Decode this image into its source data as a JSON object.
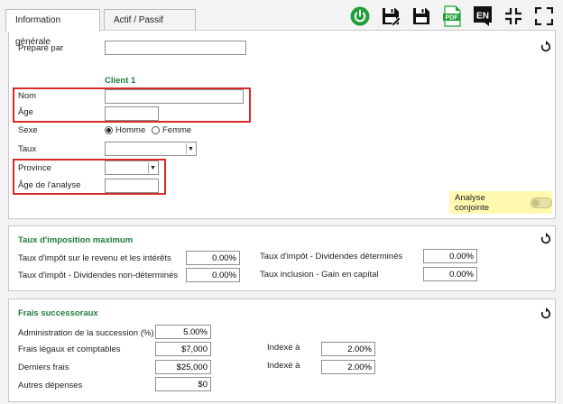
{
  "tabs": [
    {
      "label": "Information générale",
      "active": true
    },
    {
      "label": "Actif / Passif",
      "active": false
    }
  ],
  "toolbar": {
    "icons": [
      "power-icon",
      "save-edit-icon",
      "save-icon",
      "pdf-icon",
      "language-icon",
      "collapse-icon",
      "expand-icon"
    ],
    "pdf_label": "PDF",
    "language_label": "EN",
    "power_color": "#1f9e3a"
  },
  "general": {
    "prepared_by_label": "Préparé par",
    "prepared_by_value": "",
    "client_heading": "Client 1",
    "name_label": "Nom",
    "name_value": "",
    "age_label": "Âge",
    "age_value": "",
    "sex_label": "Sexe",
    "sex_options": [
      "Homme",
      "Femme"
    ],
    "sex_selected": "Homme",
    "rate_label": "Taux",
    "rate_value": "",
    "province_label": "Province",
    "province_value": "",
    "analysis_age_label": "Âge de l'analyse",
    "analysis_age_value": "",
    "joint_label": "Analyse conjointe",
    "joint_on": false
  },
  "tax": {
    "title": "Taux d'imposition maximum",
    "income_label": "Taux d'impôt sur le revenu et les intérêts",
    "income_value": "0.00%",
    "nondet_label": "Taux d'impôt - Dividendes non-déterminés",
    "nondet_value": "0.00%",
    "det_label": "Taux d'impôt - Dividendes déterminés",
    "det_value": "0.00%",
    "capgain_label": "Taux inclusion - Gain en capital",
    "capgain_value": "0.00%"
  },
  "estate": {
    "title": "Frais successoraux",
    "admin_label": "Administration de la succession (%)",
    "admin_value": "5.00%",
    "legal_label": "Frais légaux et comptables",
    "legal_value": "$7,000",
    "final_label": "Derniers frais",
    "final_value": "$25,000",
    "other_label": "Autres dépenses",
    "other_value": "$0",
    "indexed_label_1": "Indexé à",
    "indexed_value_1": "2.00%",
    "indexed_label_2": "Indexé à",
    "indexed_value_2": "2.00%"
  },
  "colors": {
    "accent_green": "#1e7c3c",
    "highlight_red": "#d62b2b",
    "highlight_yellow": "#fff9b0"
  }
}
